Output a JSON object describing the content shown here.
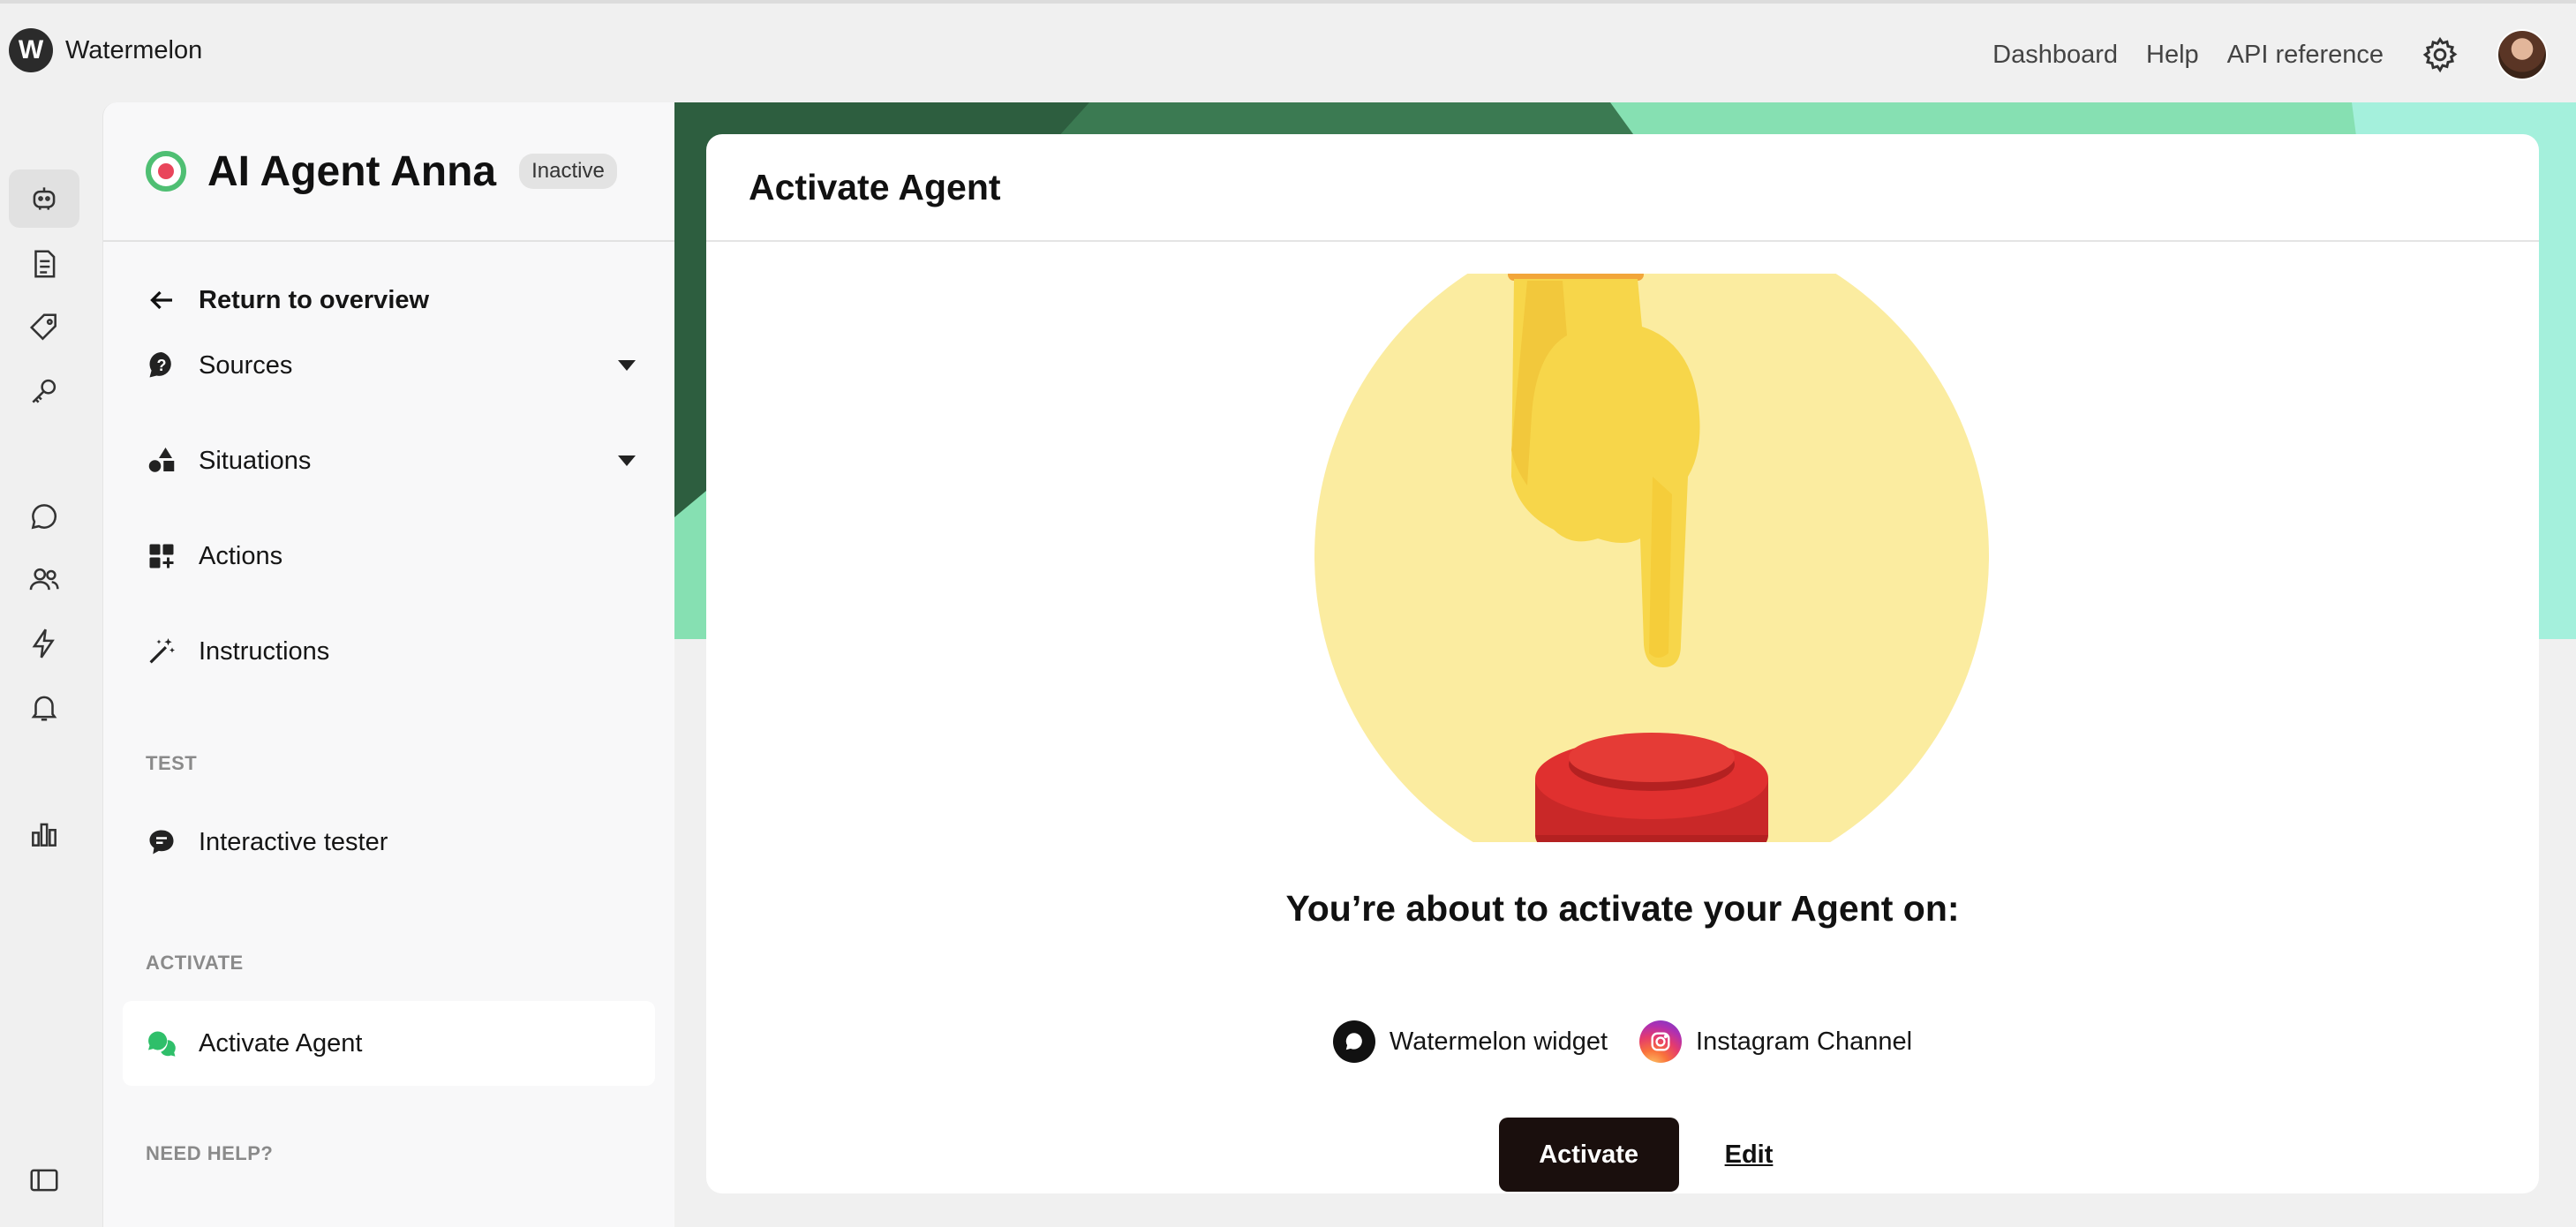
{
  "app": {
    "logo_letter": "W",
    "name": "Watermelon"
  },
  "top_nav": {
    "dashboard": "Dashboard",
    "help": "Help",
    "api_reference": "API reference"
  },
  "icon_rail": [
    "robot-icon",
    "document-icon",
    "tag-icon",
    "key-icon",
    "chat-icon",
    "users-icon",
    "lightning-icon",
    "bell-icon",
    "bar-chart-icon",
    "sidebar-toggle-icon"
  ],
  "agent": {
    "name": "AI Agent Anna",
    "status": "Inactive"
  },
  "sidebar": {
    "return_label": "Return to overview",
    "items": [
      {
        "label": "Sources",
        "icon": "question-bubble-icon"
      },
      {
        "label": "Situations",
        "icon": "shapes-icon"
      },
      {
        "label": "Actions",
        "icon": "grid-plus-icon"
      },
      {
        "label": "Instructions",
        "icon": "magic-wand-icon"
      }
    ],
    "test_section": "TEST",
    "tester_label": "Interactive tester",
    "activate_section": "ACTIVATE",
    "activate_label": "Activate Agent",
    "help_section": "NEED HELP?"
  },
  "card": {
    "title": "Activate Agent",
    "heading": "You’re about to activate your Agent on:",
    "channels": [
      {
        "label": "Watermelon widget",
        "icon": "chat-bubble-icon"
      },
      {
        "label": "Instagram Channel",
        "icon": "instagram-icon"
      }
    ],
    "activate_button": "Activate",
    "edit_link": "Edit"
  },
  "colors": {
    "accent_dark": "#1a0f0d",
    "hero_green_dark": "#2d5e3f",
    "hero_green_light": "#7ddca8",
    "illustration_yellow": "#fbeca0",
    "button_red": "#e0302f"
  }
}
